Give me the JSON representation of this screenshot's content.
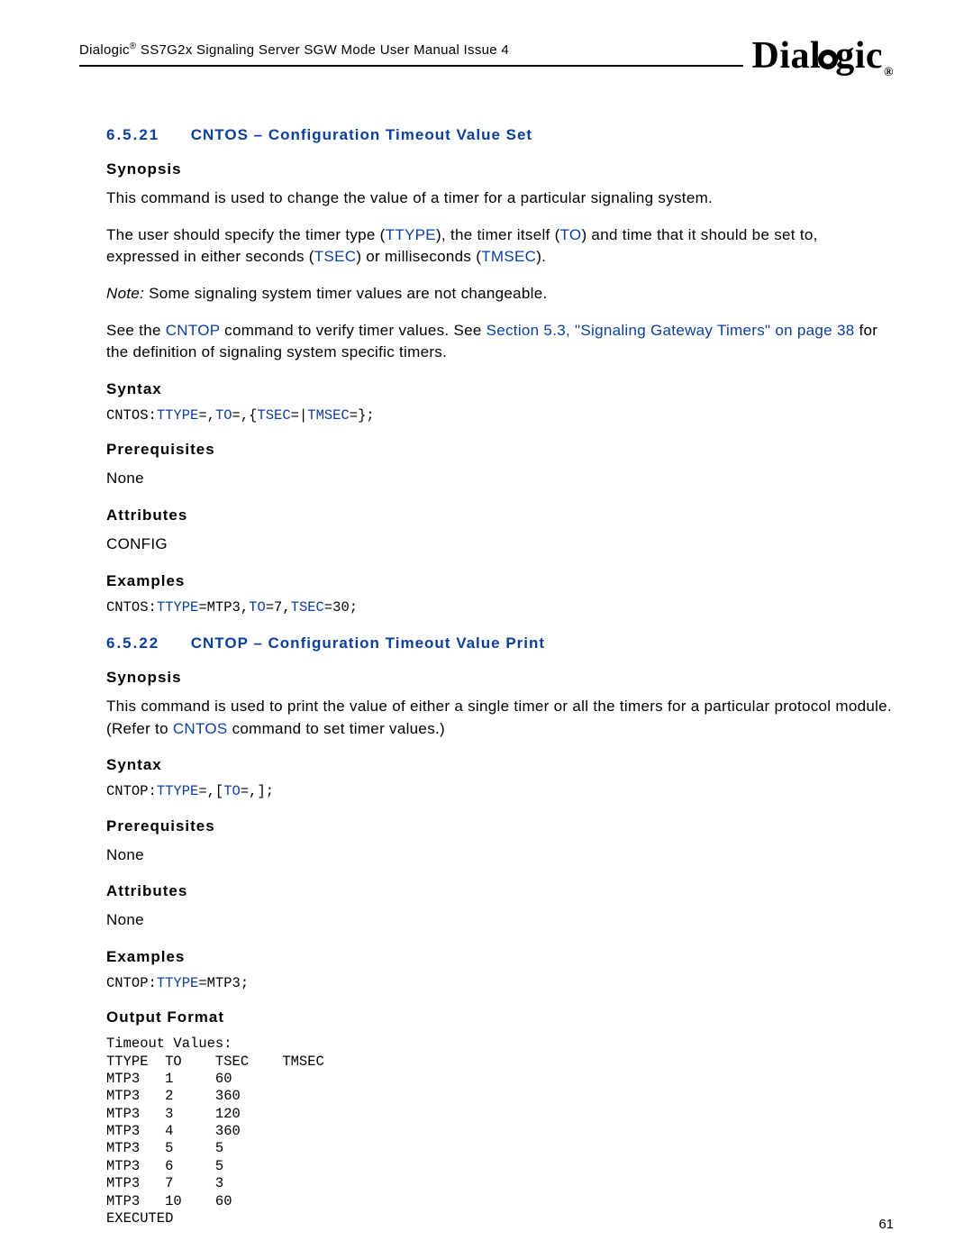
{
  "header": {
    "brand": "Dialogic",
    "doc_name_before_reg": "Dialogic",
    "doc_name_after_reg": " SS7G2x Signaling Server SGW Mode User Manual Issue 4",
    "logo_text": "Dialogic"
  },
  "page_number": "61",
  "section1": {
    "number": "6.5.21",
    "title": "CNTOS – Configuration Timeout Value Set",
    "synopsis_label": "Synopsis",
    "synopsis_p1": "This command is used to change the value of a timer for a particular signaling system.",
    "synopsis_p2a": "The user should specify the timer type (",
    "kw_ttype": "TTYPE",
    "synopsis_p2b": "), the timer itself (",
    "kw_to": "TO",
    "synopsis_p2c": ") and time that it should be set to, expressed in either seconds (",
    "kw_tsec": "TSEC",
    "synopsis_p2d": ") or milliseconds (",
    "kw_tmsec": "TMSEC",
    "synopsis_p2e": ").",
    "note_label": "Note:",
    "note_text": " Some signaling system timer values are not changeable.",
    "see_a": "See the ",
    "kw_cntop": "CNTOP",
    "see_b": " command to verify timer values. See ",
    "see_link": "Section 5.3, \"Signaling Gateway Timers\" on page 38",
    "see_c": " for the definition of signaling system specific timers.",
    "syntax_label": "Syntax",
    "syntax_line_prefix": "CNTOS:",
    "syntax_line_ttype": "TTYPE",
    "syntax_line_eq1": "=,",
    "syntax_line_to": "TO",
    "syntax_line_eq2": "=,{",
    "syntax_line_tsec": "TSEC",
    "syntax_line_eq3": "=|",
    "syntax_line_tmsec": "TMSEC",
    "syntax_line_eq4": "=};",
    "prereq_label": "Prerequisites",
    "prereq_value": "None",
    "attr_label": "Attributes",
    "attr_value": "CONFIG",
    "examples_label": "Examples",
    "ex_prefix": "CNTOS:",
    "ex_ttype": "TTYPE",
    "ex_eq1": "=MTP3,",
    "ex_to": "TO",
    "ex_eq2": "=7,",
    "ex_tsec": "TSEC",
    "ex_eq3": "=30;"
  },
  "section2": {
    "number": "6.5.22",
    "title": "CNTOP – Configuration Timeout Value Print",
    "synopsis_label": "Synopsis",
    "synopsis_p1a": "This command is used to print the value of either a single timer or all the timers for a particular protocol module. (Refer to ",
    "kw_cntos": "CNTOS",
    "synopsis_p1b": " command to set timer values.)",
    "syntax_label": "Syntax",
    "syntax_prefix": "CNTOP:",
    "syntax_ttype": "TTYPE",
    "syntax_eq1": "=,[",
    "syntax_to": "TO",
    "syntax_eq2": "=,];",
    "prereq_label": "Prerequisites",
    "prereq_value": "None",
    "attr_label": "Attributes",
    "attr_value": "None",
    "examples_label": "Examples",
    "ex_prefix": "CNTOP:",
    "ex_ttype": "TTYPE",
    "ex_eq1": "=MTP3;",
    "output_label": "Output Format",
    "output_title": "Timeout Values:",
    "output_header": {
      "c0": "TTYPE",
      "c1": "TO",
      "c2": "TSEC",
      "c3": "TMSEC"
    },
    "output_rows": [
      {
        "c0": "MTP3",
        "c1": "1",
        "c2": "60",
        "c3": ""
      },
      {
        "c0": "MTP3",
        "c1": "2",
        "c2": "360",
        "c3": ""
      },
      {
        "c0": "MTP3",
        "c1": "3",
        "c2": "120",
        "c3": ""
      },
      {
        "c0": "MTP3",
        "c1": "4",
        "c2": "360",
        "c3": ""
      },
      {
        "c0": "MTP3",
        "c1": "5",
        "c2": "5",
        "c3": ""
      },
      {
        "c0": "MTP3",
        "c1": "6",
        "c2": "5",
        "c3": ""
      },
      {
        "c0": "MTP3",
        "c1": "7",
        "c2": "3",
        "c3": ""
      },
      {
        "c0": "MTP3",
        "c1": "10",
        "c2": "60",
        "c3": ""
      }
    ],
    "output_footer": "EXECUTED"
  }
}
